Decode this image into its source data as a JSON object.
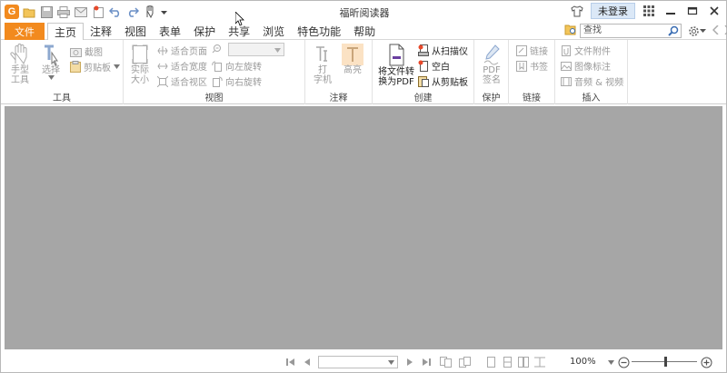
{
  "window": {
    "title": "福昕阅读器",
    "login_label": "未登录"
  },
  "ribbon_tabs": {
    "file": "文件",
    "items": [
      "主页",
      "注释",
      "视图",
      "表单",
      "保护",
      "共享",
      "浏览",
      "特色功能",
      "帮助"
    ],
    "active": "主页"
  },
  "search": {
    "placeholder": "查找"
  },
  "groups": {
    "tools": {
      "label": "工具",
      "hand": "手型\n工具",
      "select": "选择",
      "screenshot": "截图",
      "clipboard": "剪贴板"
    },
    "view": {
      "label": "视图",
      "actual_size": "实际\n大小",
      "fit_page": "适合页面",
      "fit_width": "适合宽度",
      "fit_visible": "适合视区",
      "rotate_left": "向左旋转",
      "rotate_right": "向右旋转"
    },
    "comment": {
      "label": "注释",
      "typewriter": "打\n字机",
      "highlight": "高亮"
    },
    "create": {
      "label": "创建",
      "convert": "将文件转\n换为PDF",
      "from_scanner": "从扫描仪",
      "blank": "空白",
      "from_clipboard": "从剪贴板"
    },
    "protect": {
      "label": "保护",
      "pdf_sign": "PDF\n签名"
    },
    "links": {
      "label": "链接",
      "link": "链接",
      "bookmark": "书签"
    },
    "insert": {
      "label": "插入",
      "file_attachment": "文件附件",
      "image_annotation": "图像标注",
      "audio_video": "音频 & 视频"
    }
  },
  "statusbar": {
    "zoom": "100%"
  },
  "colors": {
    "accent_orange": "#f28a1e",
    "document_bg": "#a6a6a6",
    "login_bg": "#dbe8f7"
  }
}
